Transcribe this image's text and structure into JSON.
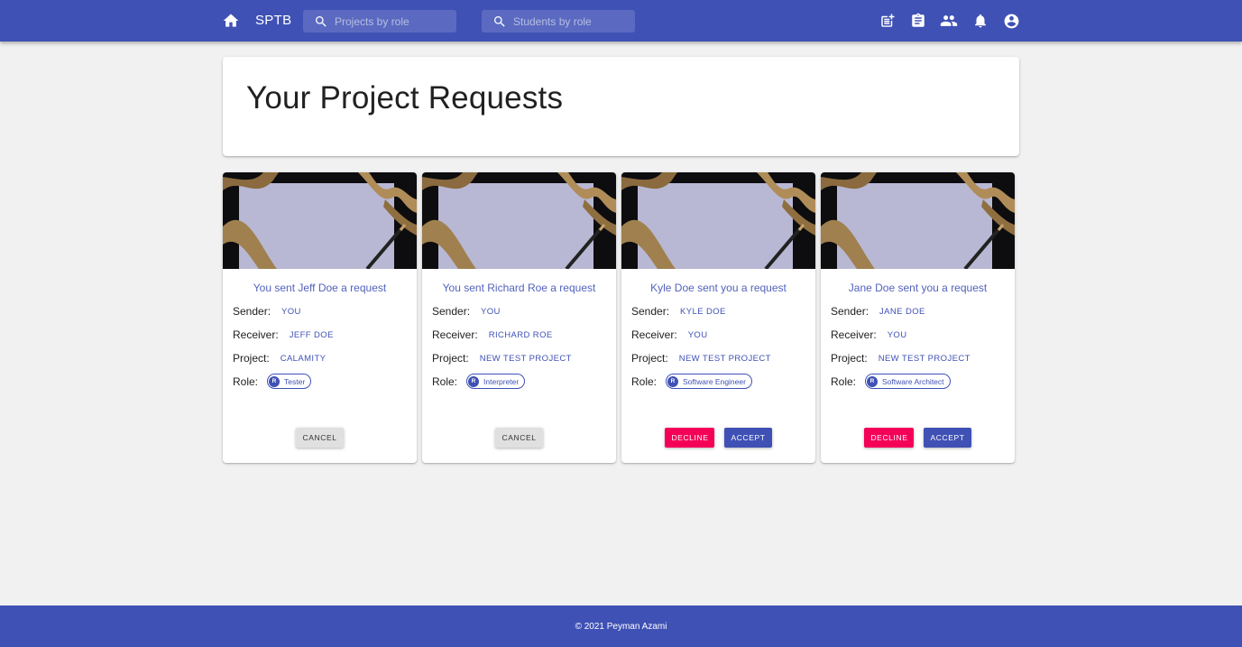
{
  "topbar": {
    "brand": "SPTB",
    "search_projects_placeholder": "Projects by role",
    "search_students_placeholder": "Students by role",
    "icons": [
      "home-icon",
      "post-add-icon",
      "assignment-icon",
      "people-icon",
      "notifications-icon",
      "account-circle-icon"
    ]
  },
  "header": {
    "title": "Your Project Requests"
  },
  "labels": {
    "sender": "Sender:",
    "receiver": "Receiver:",
    "project": "Project:",
    "role": "Role:"
  },
  "cards": [
    {
      "title": "You sent Jeff Doe a request",
      "sender": "YOU",
      "receiver": "JEFF DOE",
      "project": "CALAMITY",
      "role": "Tester",
      "role_avatar": "R",
      "buttons": [
        "CANCEL"
      ]
    },
    {
      "title": "You sent Richard Roe a request",
      "sender": "YOU",
      "receiver": "RICHARD ROE",
      "project": "NEW TEST PROJECT",
      "role": "Interpreter",
      "role_avatar": "R",
      "buttons": [
        "CANCEL"
      ]
    },
    {
      "title": "Kyle Doe sent you a request",
      "sender": "KYLE DOE",
      "receiver": "YOU",
      "project": "NEW TEST PROJECT",
      "role": "Software Engineer",
      "role_avatar": "R",
      "buttons": [
        "DECLINE",
        "ACCEPT"
      ]
    },
    {
      "title": "Jane Doe sent you a request",
      "sender": "JANE DOE",
      "receiver": "YOU",
      "project": "NEW TEST PROJECT",
      "role": "Software Architect",
      "role_avatar": "R",
      "buttons": [
        "DECLINE",
        "ACCEPT"
      ]
    }
  ],
  "footer": {
    "text": "© 2021 Peyman Azami"
  },
  "colors": {
    "primary": "#3f51b5",
    "decline": "#f50057",
    "background": "#f1f1f1"
  }
}
